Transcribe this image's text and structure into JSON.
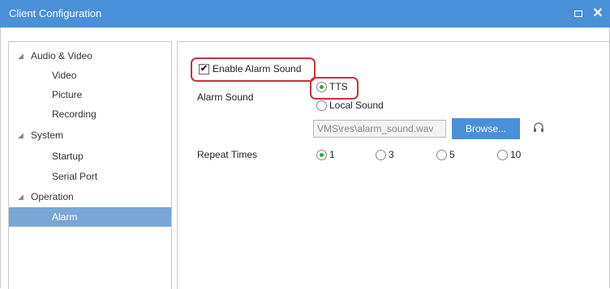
{
  "window": {
    "title": "Client Configuration",
    "maximize_icon": "maximize-icon",
    "close_icon": "close-icon",
    "close_glyph": "✕"
  },
  "tree": {
    "groups": [
      {
        "label": "Audio & Video",
        "children": [
          "Video",
          "Picture",
          "Recording"
        ]
      },
      {
        "label": "System",
        "children": [
          "Startup",
          "Serial Port"
        ]
      },
      {
        "label": "Operation",
        "children": [
          "Alarm"
        ]
      }
    ],
    "selected": "Alarm",
    "expand_glyph": "◢"
  },
  "alarm": {
    "enable_label": "Enable Alarm Sound",
    "enable_checked": true,
    "check_glyph": "✔",
    "sound_label": "Alarm Sound",
    "sound_options": [
      {
        "label": "TTS",
        "selected": true
      },
      {
        "label": "Local Sound",
        "selected": false
      }
    ],
    "path_value": "VMS\\res\\alarm_sound.wav",
    "browse_label": "Browse...",
    "headphone_icon": "headphones-icon",
    "repeat_label": "Repeat Times",
    "repeat_options": [
      {
        "label": "1",
        "selected": true
      },
      {
        "label": "3",
        "selected": false
      },
      {
        "label": "5",
        "selected": false
      },
      {
        "label": "10",
        "selected": false
      }
    ]
  },
  "colors": {
    "accent": "#4a90d9",
    "highlight": "#c8323a",
    "selected_row": "#7aa6d6",
    "radio_on": "#2aa944"
  }
}
